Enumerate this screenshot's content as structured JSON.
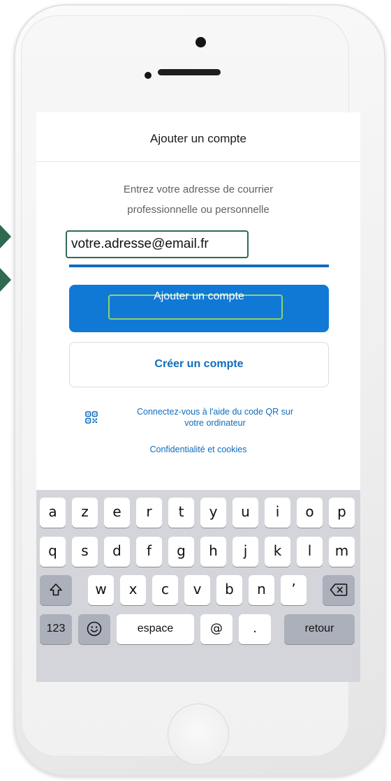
{
  "header": {
    "title": "Ajouter un compte"
  },
  "instruction": {
    "line1": "Entrez votre adresse de courrier",
    "line2": "professionnelle ou personnelle"
  },
  "email_field": {
    "value": "votre.adresse@email.fr"
  },
  "buttons": {
    "add_account": "Ajouter un compte",
    "create_account": "Créer un compte"
  },
  "qr": {
    "icon": "qr-code-icon",
    "line1": "Connectez-vous à l'aide du code QR sur",
    "line2": "votre ordinateur"
  },
  "privacy_link": "Confidentialité et cookies",
  "keyboard": {
    "row1": [
      "a",
      "z",
      "e",
      "r",
      "t",
      "y",
      "u",
      "i",
      "o",
      "p"
    ],
    "row2": [
      "q",
      "s",
      "d",
      "f",
      "g",
      "h",
      "j",
      "k",
      "l",
      "m"
    ],
    "row3": [
      "w",
      "x",
      "c",
      "v",
      "b",
      "n",
      "’"
    ],
    "shift_icon": "shift-icon",
    "backspace_icon": "backspace-icon",
    "key_123": "123",
    "emoji_icon": "emoji-icon",
    "space": "espace",
    "at": "@",
    "period": ".",
    "return": "retour"
  },
  "colors": {
    "accent": "#1079d5",
    "link": "#0f6cbd",
    "highlight_frame": "#2f6b4f",
    "button_highlight": "#8dd46a",
    "arrow": "#2d6a4f"
  }
}
